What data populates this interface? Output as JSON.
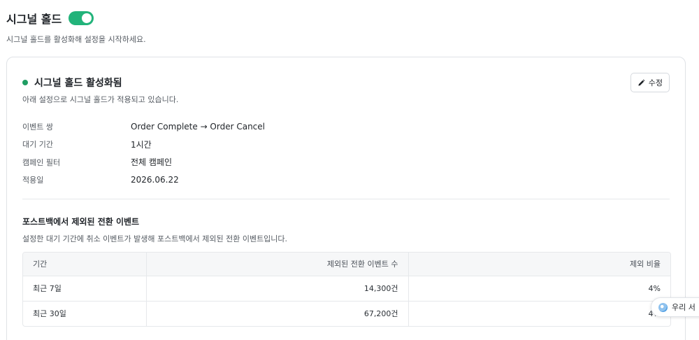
{
  "header": {
    "title": "시그널 홀드",
    "toggle_on": true,
    "description": "시그널 홀드를 활성화해 설정을 시작하세요."
  },
  "status": {
    "title": "시그널 홀드 활성화됨",
    "description": "아래 설정으로 시그널 홀드가 적용되고 있습니다.",
    "edit_label": "수정",
    "dot_color": "#1f9d63"
  },
  "settings": [
    {
      "label": "이벤트 쌍",
      "value": "Order Complete → Order Cancel"
    },
    {
      "label": "대기 기간",
      "value": "1시간"
    },
    {
      "label": "캠페인 필터",
      "value": "전체 캠페인"
    },
    {
      "label": "적용일",
      "value": "2026.06.22"
    }
  ],
  "excluded": {
    "title": "포스트백에서 제외된 전환 이벤트",
    "description": "설정한 대기 기간에 취소 이벤트가 발생해 포스트백에서 제외된 전환 이벤트입니다.",
    "columns": [
      "기간",
      "제외된 전환 이벤트 수",
      "제외 비율"
    ],
    "rows": [
      {
        "period": "최근 7일",
        "count": "14,300건",
        "ratio": "4%"
      },
      {
        "period": "최근 30일",
        "count": "67,200건",
        "ratio": "4%"
      }
    ]
  },
  "chat_widget": {
    "label": "우리 서"
  },
  "colors": {
    "accent": "#22b37a"
  }
}
